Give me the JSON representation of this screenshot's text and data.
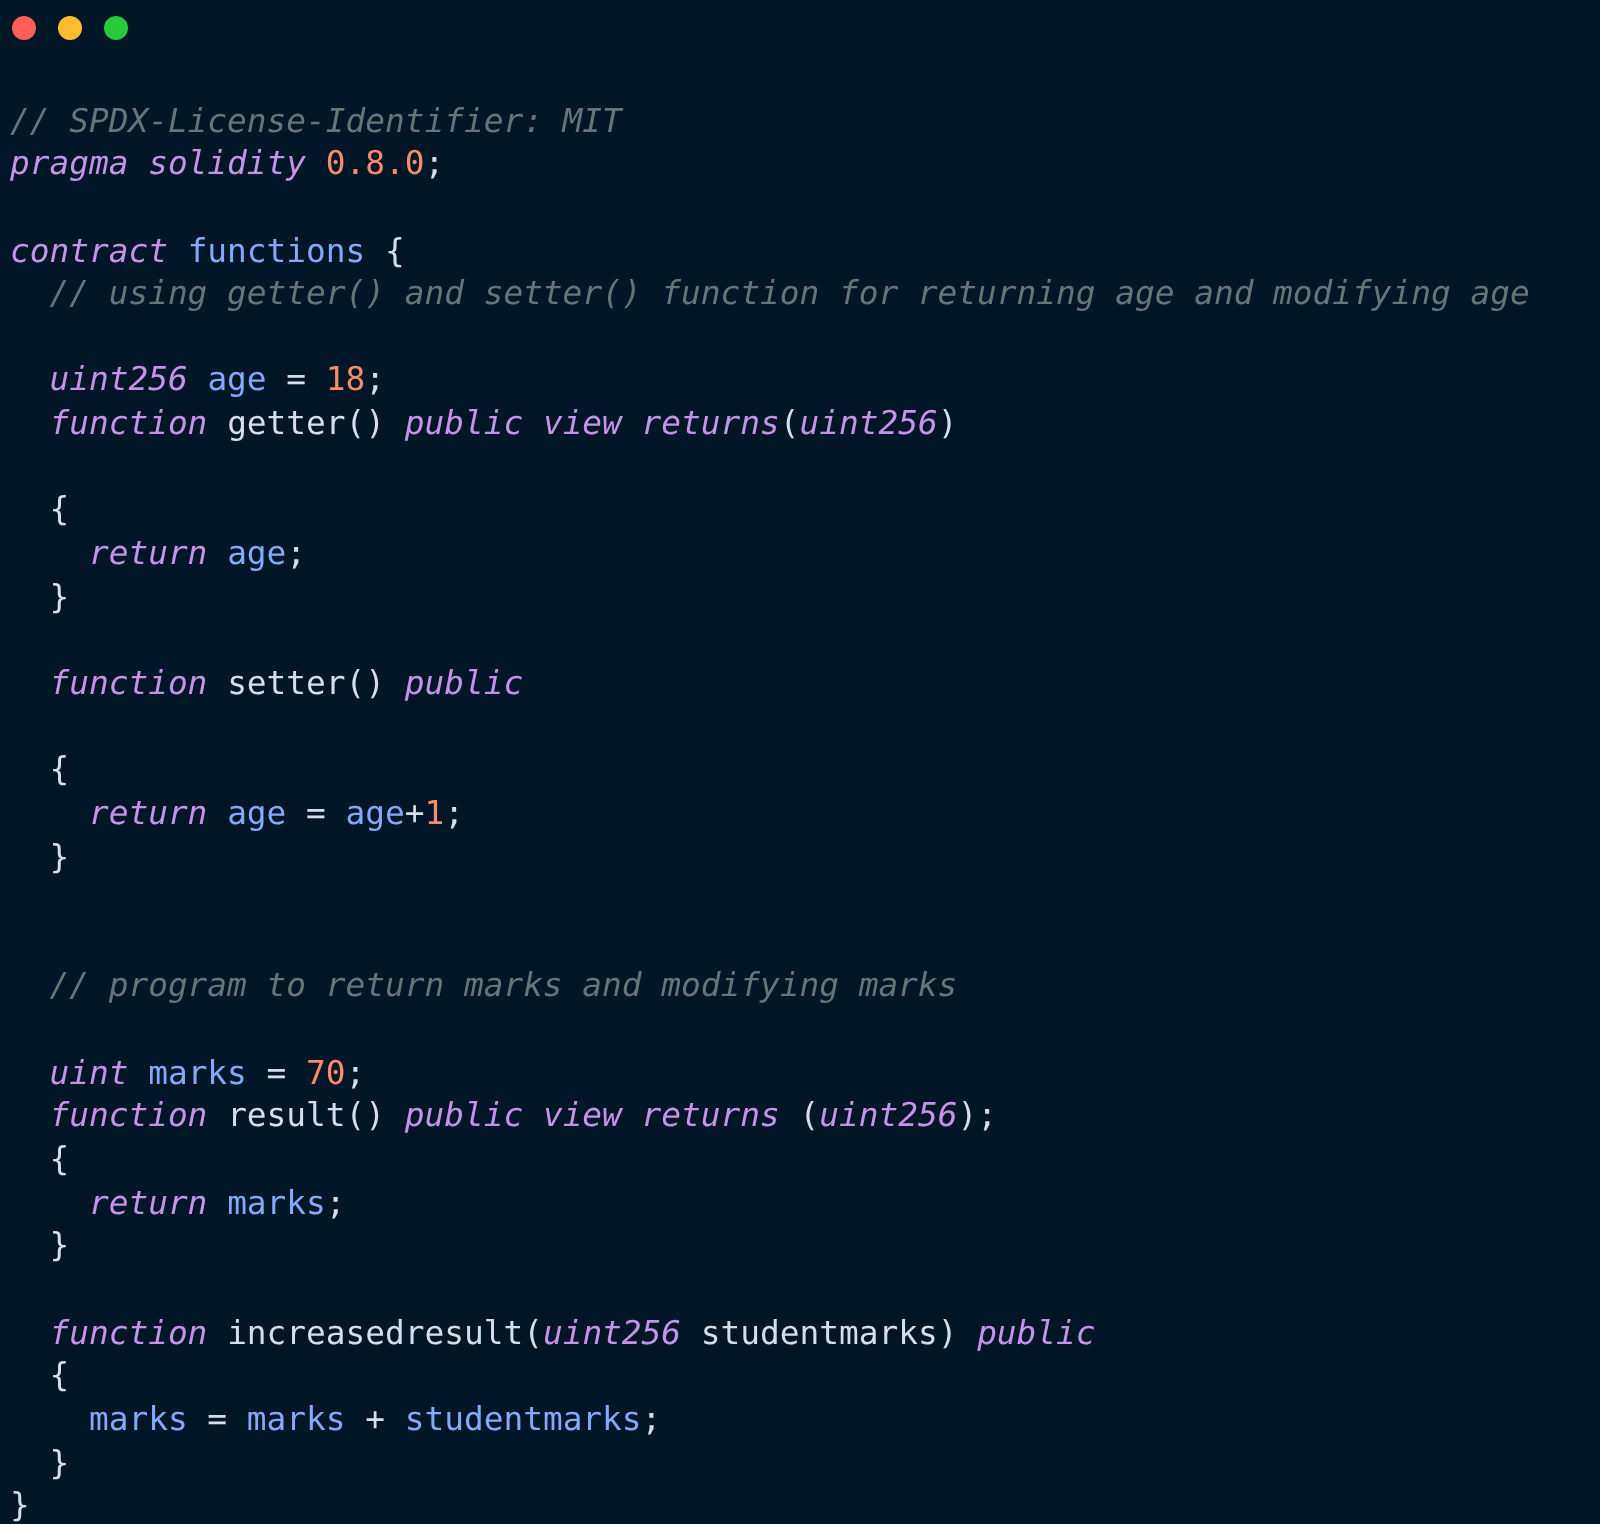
{
  "window": {
    "controls": [
      {
        "color": "#ff5f56"
      },
      {
        "color": "#ffbd2e"
      },
      {
        "color": "#27c93f"
      }
    ]
  },
  "code_blocks": [
    {
      "kind": "block",
      "lines": [
        [
          {
            "text": "// SPDX-License-Identifier: MIT",
            "kind": "comment"
          }
        ],
        [
          {
            "text": "pragma solidity ",
            "kind": "keyword"
          },
          {
            "text": "0.8.0",
            "kind": "number"
          },
          {
            "text": ";",
            "kind": "plain"
          }
        ]
      ]
    },
    {
      "kind": "block",
      "lines": [
        [
          {
            "text": "contract ",
            "kind": "keyword"
          },
          {
            "text": "functions",
            "kind": "variable"
          },
          {
            "text": " {",
            "kind": "plain"
          }
        ],
        [
          {
            "text": "  // using getter() and setter() function for returning age and modifying age",
            "kind": "comment"
          }
        ]
      ]
    },
    {
      "kind": "block",
      "lines": [
        [
          {
            "text": "  uint256 ",
            "kind": "keyword"
          },
          {
            "text": "age",
            "kind": "variable"
          },
          {
            "text": " = ",
            "kind": "plain"
          },
          {
            "text": "18",
            "kind": "number"
          },
          {
            "text": ";",
            "kind": "plain"
          }
        ],
        [
          {
            "text": "  function ",
            "kind": "keyword"
          },
          {
            "text": "getter() ",
            "kind": "plain"
          },
          {
            "text": "public view returns",
            "kind": "keyword"
          },
          {
            "text": "(",
            "kind": "plain"
          },
          {
            "text": "uint256",
            "kind": "keyword"
          },
          {
            "text": ")",
            "kind": "plain"
          }
        ]
      ]
    },
    {
      "kind": "block",
      "lines": [
        [
          {
            "text": "  {",
            "kind": "plain"
          }
        ],
        [
          {
            "text": "    return ",
            "kind": "keyword"
          },
          {
            "text": "age",
            "kind": "variable"
          },
          {
            "text": ";",
            "kind": "plain"
          }
        ],
        [
          {
            "text": "  }",
            "kind": "plain"
          }
        ]
      ]
    },
    {
      "kind": "block",
      "lines": [
        [
          {
            "text": "  function ",
            "kind": "keyword"
          },
          {
            "text": "setter() ",
            "kind": "plain"
          },
          {
            "text": "public",
            "kind": "keyword"
          }
        ]
      ]
    },
    {
      "kind": "block",
      "lines": [
        [
          {
            "text": "  {",
            "kind": "plain"
          }
        ],
        [
          {
            "text": "    return ",
            "kind": "keyword"
          },
          {
            "text": "age",
            "kind": "variable"
          },
          {
            "text": " = ",
            "kind": "plain"
          },
          {
            "text": "age",
            "kind": "variable"
          },
          {
            "text": "+",
            "kind": "plain"
          },
          {
            "text": "1",
            "kind": "number"
          },
          {
            "text": ";",
            "kind": "plain"
          }
        ],
        [
          {
            "text": "  }",
            "kind": "plain"
          }
        ]
      ]
    },
    {
      "kind": "section",
      "lines": [
        [
          {
            "text": "  // program to return marks and modifying marks",
            "kind": "comment"
          }
        ]
      ]
    },
    {
      "kind": "block",
      "lines": [
        [
          {
            "text": "  uint ",
            "kind": "keyword"
          },
          {
            "text": "marks",
            "kind": "variable"
          },
          {
            "text": " = ",
            "kind": "plain"
          },
          {
            "text": "70",
            "kind": "number"
          },
          {
            "text": ";",
            "kind": "plain"
          }
        ],
        [
          {
            "text": "  function ",
            "kind": "keyword"
          },
          {
            "text": "result() ",
            "kind": "plain"
          },
          {
            "text": "public view returns ",
            "kind": "keyword"
          },
          {
            "text": "(",
            "kind": "plain"
          },
          {
            "text": "uint256",
            "kind": "keyword"
          },
          {
            "text": ");",
            "kind": "plain"
          }
        ],
        [
          {
            "text": "  {",
            "kind": "plain"
          }
        ],
        [
          {
            "text": "    return ",
            "kind": "keyword"
          },
          {
            "text": "marks",
            "kind": "variable"
          },
          {
            "text": ";",
            "kind": "plain"
          }
        ],
        [
          {
            "text": "  }",
            "kind": "plain"
          }
        ]
      ]
    },
    {
      "kind": "block",
      "lines": [
        [
          {
            "text": "  function ",
            "kind": "keyword"
          },
          {
            "text": "increasedresult(",
            "kind": "plain"
          },
          {
            "text": "uint256 ",
            "kind": "keyword"
          },
          {
            "text": "studentmarks) ",
            "kind": "plain"
          },
          {
            "text": "public",
            "kind": "keyword"
          }
        ],
        [
          {
            "text": "  {",
            "kind": "plain"
          }
        ],
        [
          {
            "text": "    marks",
            "kind": "variable"
          },
          {
            "text": " = ",
            "kind": "plain"
          },
          {
            "text": "marks",
            "kind": "variable"
          },
          {
            "text": " + ",
            "kind": "plain"
          },
          {
            "text": "studentmarks",
            "kind": "variable"
          },
          {
            "text": ";",
            "kind": "plain"
          }
        ],
        [
          {
            "text": "  }",
            "kind": "plain"
          }
        ],
        [
          {
            "text": "}",
            "kind": "plain"
          }
        ]
      ]
    }
  ]
}
